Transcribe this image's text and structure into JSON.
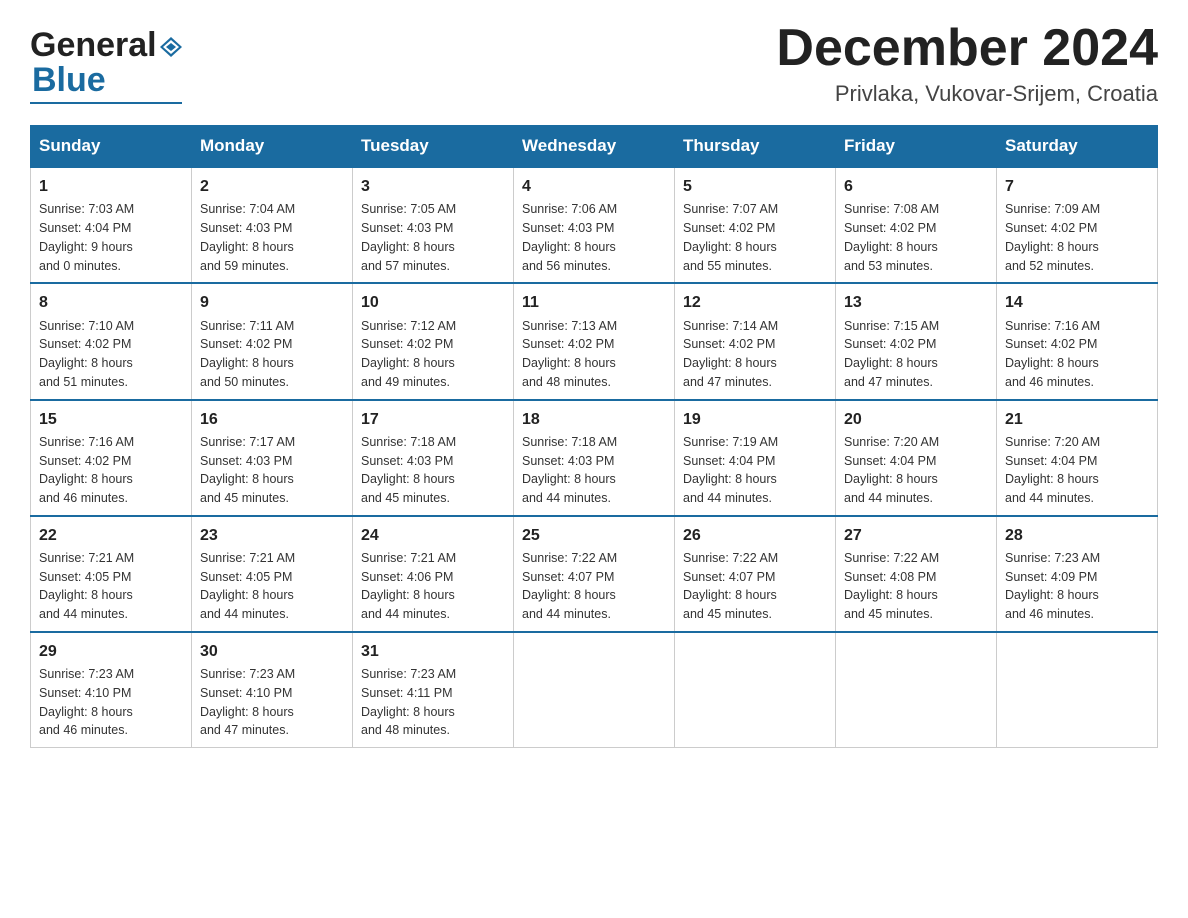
{
  "header": {
    "logo_general": "General",
    "logo_blue": "Blue",
    "month_title": "December 2024",
    "location": "Privlaka, Vukovar-Srijem, Croatia"
  },
  "days_of_week": [
    "Sunday",
    "Monday",
    "Tuesday",
    "Wednesday",
    "Thursday",
    "Friday",
    "Saturday"
  ],
  "weeks": [
    [
      {
        "num": "1",
        "info": "Sunrise: 7:03 AM\nSunset: 4:04 PM\nDaylight: 9 hours\nand 0 minutes."
      },
      {
        "num": "2",
        "info": "Sunrise: 7:04 AM\nSunset: 4:03 PM\nDaylight: 8 hours\nand 59 minutes."
      },
      {
        "num": "3",
        "info": "Sunrise: 7:05 AM\nSunset: 4:03 PM\nDaylight: 8 hours\nand 57 minutes."
      },
      {
        "num": "4",
        "info": "Sunrise: 7:06 AM\nSunset: 4:03 PM\nDaylight: 8 hours\nand 56 minutes."
      },
      {
        "num": "5",
        "info": "Sunrise: 7:07 AM\nSunset: 4:02 PM\nDaylight: 8 hours\nand 55 minutes."
      },
      {
        "num": "6",
        "info": "Sunrise: 7:08 AM\nSunset: 4:02 PM\nDaylight: 8 hours\nand 53 minutes."
      },
      {
        "num": "7",
        "info": "Sunrise: 7:09 AM\nSunset: 4:02 PM\nDaylight: 8 hours\nand 52 minutes."
      }
    ],
    [
      {
        "num": "8",
        "info": "Sunrise: 7:10 AM\nSunset: 4:02 PM\nDaylight: 8 hours\nand 51 minutes."
      },
      {
        "num": "9",
        "info": "Sunrise: 7:11 AM\nSunset: 4:02 PM\nDaylight: 8 hours\nand 50 minutes."
      },
      {
        "num": "10",
        "info": "Sunrise: 7:12 AM\nSunset: 4:02 PM\nDaylight: 8 hours\nand 49 minutes."
      },
      {
        "num": "11",
        "info": "Sunrise: 7:13 AM\nSunset: 4:02 PM\nDaylight: 8 hours\nand 48 minutes."
      },
      {
        "num": "12",
        "info": "Sunrise: 7:14 AM\nSunset: 4:02 PM\nDaylight: 8 hours\nand 47 minutes."
      },
      {
        "num": "13",
        "info": "Sunrise: 7:15 AM\nSunset: 4:02 PM\nDaylight: 8 hours\nand 47 minutes."
      },
      {
        "num": "14",
        "info": "Sunrise: 7:16 AM\nSunset: 4:02 PM\nDaylight: 8 hours\nand 46 minutes."
      }
    ],
    [
      {
        "num": "15",
        "info": "Sunrise: 7:16 AM\nSunset: 4:02 PM\nDaylight: 8 hours\nand 46 minutes."
      },
      {
        "num": "16",
        "info": "Sunrise: 7:17 AM\nSunset: 4:03 PM\nDaylight: 8 hours\nand 45 minutes."
      },
      {
        "num": "17",
        "info": "Sunrise: 7:18 AM\nSunset: 4:03 PM\nDaylight: 8 hours\nand 45 minutes."
      },
      {
        "num": "18",
        "info": "Sunrise: 7:18 AM\nSunset: 4:03 PM\nDaylight: 8 hours\nand 44 minutes."
      },
      {
        "num": "19",
        "info": "Sunrise: 7:19 AM\nSunset: 4:04 PM\nDaylight: 8 hours\nand 44 minutes."
      },
      {
        "num": "20",
        "info": "Sunrise: 7:20 AM\nSunset: 4:04 PM\nDaylight: 8 hours\nand 44 minutes."
      },
      {
        "num": "21",
        "info": "Sunrise: 7:20 AM\nSunset: 4:04 PM\nDaylight: 8 hours\nand 44 minutes."
      }
    ],
    [
      {
        "num": "22",
        "info": "Sunrise: 7:21 AM\nSunset: 4:05 PM\nDaylight: 8 hours\nand 44 minutes."
      },
      {
        "num": "23",
        "info": "Sunrise: 7:21 AM\nSunset: 4:05 PM\nDaylight: 8 hours\nand 44 minutes."
      },
      {
        "num": "24",
        "info": "Sunrise: 7:21 AM\nSunset: 4:06 PM\nDaylight: 8 hours\nand 44 minutes."
      },
      {
        "num": "25",
        "info": "Sunrise: 7:22 AM\nSunset: 4:07 PM\nDaylight: 8 hours\nand 44 minutes."
      },
      {
        "num": "26",
        "info": "Sunrise: 7:22 AM\nSunset: 4:07 PM\nDaylight: 8 hours\nand 45 minutes."
      },
      {
        "num": "27",
        "info": "Sunrise: 7:22 AM\nSunset: 4:08 PM\nDaylight: 8 hours\nand 45 minutes."
      },
      {
        "num": "28",
        "info": "Sunrise: 7:23 AM\nSunset: 4:09 PM\nDaylight: 8 hours\nand 46 minutes."
      }
    ],
    [
      {
        "num": "29",
        "info": "Sunrise: 7:23 AM\nSunset: 4:10 PM\nDaylight: 8 hours\nand 46 minutes."
      },
      {
        "num": "30",
        "info": "Sunrise: 7:23 AM\nSunset: 4:10 PM\nDaylight: 8 hours\nand 47 minutes."
      },
      {
        "num": "31",
        "info": "Sunrise: 7:23 AM\nSunset: 4:11 PM\nDaylight: 8 hours\nand 48 minutes."
      },
      {
        "num": "",
        "info": ""
      },
      {
        "num": "",
        "info": ""
      },
      {
        "num": "",
        "info": ""
      },
      {
        "num": "",
        "info": ""
      }
    ]
  ]
}
